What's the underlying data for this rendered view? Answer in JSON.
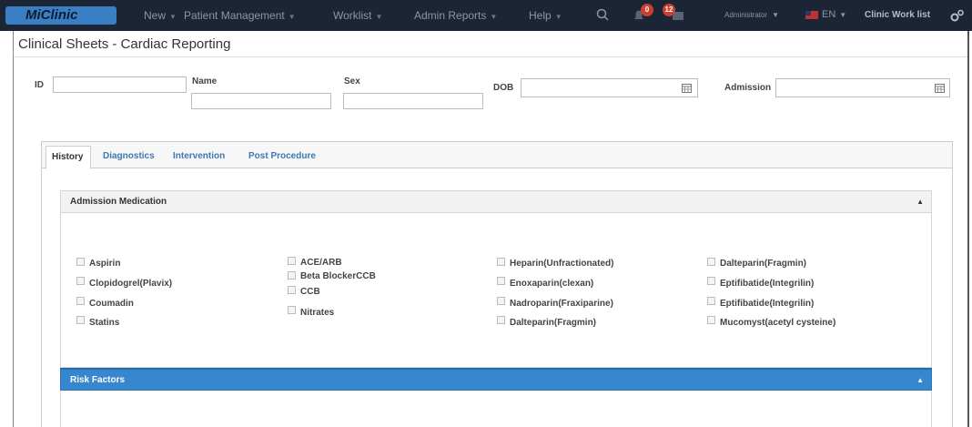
{
  "nav": {
    "logo": "MiClinic",
    "menu": [
      "New",
      "Patient Management",
      "Worklist",
      "Admin Reports",
      "Help"
    ],
    "alerts_badge": "0",
    "messages_badge": "12",
    "user": "Administrator",
    "language": "EN",
    "worklist_title": "Clinic Work list"
  },
  "page": {
    "title": "Clinical Sheets - Cardiac Reporting"
  },
  "patient": {
    "id_label": "ID",
    "name_label": "Name",
    "sex_label": "Sex",
    "dob_label": "DOB",
    "admission_label": "Admission",
    "id_value": "",
    "name_value": "",
    "sex_value": "",
    "dob_value": "",
    "admission_value": ""
  },
  "tabs": [
    "History",
    "Diagnostics",
    "Intervention",
    "Post Procedure"
  ],
  "active_tab": "History",
  "sections": {
    "admission_medication": "Admission Medication",
    "risk_factors": "Risk Factors",
    "expanded_toggle": "▲"
  },
  "medications": [
    [
      "Aspirin",
      "Clopidogrel(Plavix)",
      "Coumadin",
      "Statins"
    ],
    [
      "ACE/ARB",
      "Beta BlockerCCB",
      "CCB",
      "Nitrates"
    ],
    [
      "Heparin(Unfractionated)",
      "Enoxaparin(clexan)",
      "Nadroparin(Fraxiparine)",
      "Dalteparin(Fragmin)"
    ],
    [
      "Dalteparin(Fragmin)",
      "Eptifibatide(Integrilin)",
      "Eptifibatide(Integrilin)",
      "Mucomyst(acetyl cysteine)"
    ]
  ],
  "colors": {
    "navbar": "#1b2535",
    "accent_blue": "#3787cf",
    "tab_link": "#3c78b4",
    "badge_red": "#c8402f"
  }
}
